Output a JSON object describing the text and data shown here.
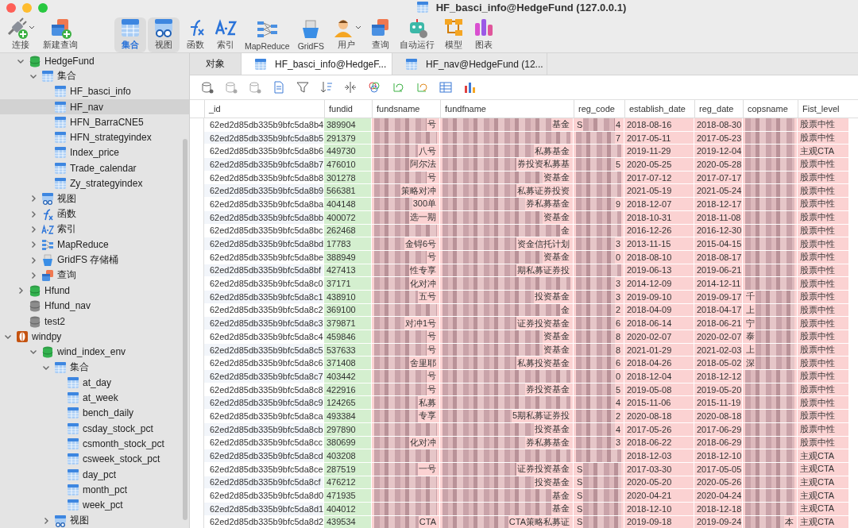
{
  "window": {
    "title": "HF_basci_info@HedgeFund (127.0.0.1)"
  },
  "toolbar": [
    {
      "kind": "connect",
      "label": "连接",
      "dropdown": true,
      "selected": false,
      "highlighted": false
    },
    {
      "kind": "new-query",
      "label": "新建查询",
      "dropdown": false,
      "selected": false,
      "highlighted": false
    },
    {
      "kind": "collection",
      "label": "集合",
      "dropdown": false,
      "selected": true,
      "highlighted": true
    },
    {
      "kind": "view",
      "label": "视图",
      "dropdown": false,
      "selected": false,
      "highlighted": true
    },
    {
      "kind": "function",
      "label": "函数",
      "dropdown": false,
      "selected": false,
      "highlighted": false
    },
    {
      "kind": "index",
      "label": "索引",
      "dropdown": false,
      "selected": false,
      "highlighted": false
    },
    {
      "kind": "mapreduce",
      "label": "MapReduce",
      "dropdown": false,
      "selected": false,
      "highlighted": false
    },
    {
      "kind": "gridfs",
      "label": "GridFS",
      "dropdown": false,
      "selected": false,
      "highlighted": false
    },
    {
      "kind": "user",
      "label": "用户",
      "dropdown": true,
      "selected": false,
      "highlighted": false
    },
    {
      "kind": "query",
      "label": "查询",
      "dropdown": false,
      "selected": false,
      "highlighted": false
    },
    {
      "kind": "robot",
      "label": "自动运行",
      "dropdown": false,
      "selected": false,
      "highlighted": false
    },
    {
      "kind": "model",
      "label": "模型",
      "dropdown": false,
      "selected": false,
      "highlighted": false
    },
    {
      "kind": "chart",
      "label": "图表",
      "dropdown": false,
      "selected": false,
      "highlighted": false
    }
  ],
  "sidebar": {
    "items": [
      {
        "kind": "database",
        "label": "HedgeFund",
        "expanded": true,
        "selected": false,
        "children": [
          {
            "kind": "collection",
            "label": "集合",
            "expanded": true,
            "selected": false,
            "children": [
              {
                "kind": "table",
                "label": "HF_basci_info",
                "selected": false
              },
              {
                "kind": "table",
                "label": "HF_nav",
                "selected": true
              },
              {
                "kind": "table",
                "label": "HFN_BarraCNE5",
                "selected": false
              },
              {
                "kind": "table",
                "label": "HFN_strategyindex",
                "selected": false
              },
              {
                "kind": "table",
                "label": "Index_price",
                "selected": false
              },
              {
                "kind": "table",
                "label": "Trade_calendar",
                "selected": false
              },
              {
                "kind": "table",
                "label": "Zy_strategyindex",
                "selected": false
              }
            ]
          },
          {
            "kind": "view",
            "label": "视图",
            "expanded": false,
            "selected": false
          },
          {
            "kind": "function",
            "label": "函数",
            "expanded": false,
            "selected": false
          },
          {
            "kind": "index",
            "label": "索引",
            "expanded": false,
            "selected": false
          },
          {
            "kind": "mapreduce",
            "label": "MapReduce",
            "expanded": false,
            "selected": false
          },
          {
            "kind": "gridfs",
            "label": "GridFS 存储桶",
            "expanded": false,
            "selected": false
          },
          {
            "kind": "query",
            "label": "查询",
            "expanded": false,
            "selected": false
          }
        ]
      },
      {
        "kind": "database",
        "label": "Hfund",
        "expanded": false,
        "selected": false
      },
      {
        "kind": "database-closed",
        "label": "Hfund_nav",
        "selected": false
      },
      {
        "kind": "database-closed",
        "label": "test2",
        "selected": false
      },
      {
        "kind": "connection",
        "label": "windpy",
        "expanded": true,
        "selected": false,
        "children": [
          {
            "kind": "database",
            "label": "wind_index_env",
            "expanded": true,
            "selected": false,
            "children": [
              {
                "kind": "collection",
                "label": "集合",
                "expanded": true,
                "selected": false,
                "children": [
                  {
                    "kind": "table",
                    "label": "at_day",
                    "selected": false
                  },
                  {
                    "kind": "table",
                    "label": "at_week",
                    "selected": false
                  },
                  {
                    "kind": "table",
                    "label": "bench_daily",
                    "selected": false
                  },
                  {
                    "kind": "table",
                    "label": "csday_stock_pct",
                    "selected": false
                  },
                  {
                    "kind": "table",
                    "label": "csmonth_stock_pct",
                    "selected": false
                  },
                  {
                    "kind": "table",
                    "label": "csweek_stock_pct",
                    "selected": false
                  },
                  {
                    "kind": "table",
                    "label": "day_pct",
                    "selected": false
                  },
                  {
                    "kind": "table",
                    "label": "month_pct",
                    "selected": false
                  },
                  {
                    "kind": "table",
                    "label": "week_pct",
                    "selected": false
                  }
                ]
              },
              {
                "kind": "view",
                "label": "视图",
                "expanded": false,
                "selected": false
              }
            ]
          }
        ]
      }
    ]
  },
  "tabs": [
    {
      "label": "对象",
      "selected": false,
      "icon": false
    },
    {
      "label": "HF_basci_info@HedgeF...",
      "selected": true,
      "icon": true
    },
    {
      "label": "HF_nav@HedgeFund (12...",
      "selected": false,
      "icon": true
    }
  ],
  "table": {
    "columns": [
      "_id",
      "fundid",
      "fundsname",
      "fundfname",
      "reg_code",
      "establish_date",
      "reg_date",
      "copsname",
      "Fist_level"
    ],
    "rows": [
      {
        "id": "62ed2d85db335b9bfc5da8b4",
        "fundid": "389904",
        "fundsname": "号",
        "fundfname": "基金",
        "reg_head": "S",
        "reg_tail": "4",
        "establish_date": "2018-08-16",
        "reg_date": "2018-08-30",
        "cops_head": "",
        "cops_tail": "",
        "level": "股票中性"
      },
      {
        "id": "62ed2d85db335b9bfc5da8b5",
        "fundid": "291379",
        "fundsname": "",
        "fundfname": "",
        "reg_head": "",
        "reg_tail": "7",
        "establish_date": "2017-05-11",
        "reg_date": "2017-05-23",
        "cops_head": "",
        "cops_tail": "",
        "level": "股票中性"
      },
      {
        "id": "62ed2d85db335b9bfc5da8b6",
        "fundid": "449730",
        "fundsname": "八号",
        "fundfname": "私募基金",
        "reg_head": "",
        "reg_tail": "",
        "establish_date": "2019-11-29",
        "reg_date": "2019-12-04",
        "cops_head": "",
        "cops_tail": "",
        "level": "主观CTA"
      },
      {
        "id": "62ed2d85db335b9bfc5da8b7",
        "fundid": "476010",
        "fundsname": "阿尔法",
        "fundfname": "券投资私募基",
        "reg_head": "",
        "reg_tail": "5",
        "establish_date": "2020-05-25",
        "reg_date": "2020-05-28",
        "cops_head": "",
        "cops_tail": "",
        "level": "股票中性"
      },
      {
        "id": "62ed2d85db335b9bfc5da8b8",
        "fundid": "301278",
        "fundsname": "号",
        "fundfname": "资基金",
        "reg_head": "",
        "reg_tail": "",
        "establish_date": "2017-07-12",
        "reg_date": "2017-07-17",
        "cops_head": "",
        "cops_tail": "",
        "level": "股票中性"
      },
      {
        "id": "62ed2d85db335b9bfc5da8b9",
        "fundid": "566381",
        "fundsname": "策略对冲",
        "fundfname": "私募证券投资",
        "reg_head": "",
        "reg_tail": "",
        "establish_date": "2021-05-19",
        "reg_date": "2021-05-24",
        "cops_head": "",
        "cops_tail": "",
        "level": "股票中性"
      },
      {
        "id": "62ed2d85db335b9bfc5da8ba",
        "fundid": "404148",
        "fundsname": "300单",
        "fundfname": "券私募基金",
        "reg_head": "",
        "reg_tail": "9",
        "establish_date": "2018-12-07",
        "reg_date": "2018-12-17",
        "cops_head": "",
        "cops_tail": "",
        "level": "股票中性"
      },
      {
        "id": "62ed2d85db335b9bfc5da8bb",
        "fundid": "400072",
        "fundsname": "选一期",
        "fundfname": "资基金",
        "reg_head": "",
        "reg_tail": "",
        "establish_date": "2018-10-31",
        "reg_date": "2018-11-08",
        "cops_head": "",
        "cops_tail": "",
        "level": "股票中性"
      },
      {
        "id": "62ed2d85db335b9bfc5da8bc",
        "fundid": "262468",
        "fundsname": "",
        "fundfname": "金",
        "reg_head": "",
        "reg_tail": "",
        "establish_date": "2016-12-26",
        "reg_date": "2016-12-30",
        "cops_head": "",
        "cops_tail": "",
        "level": "股票中性"
      },
      {
        "id": "62ed2d85db335b9bfc5da8bd",
        "fundid": "17783",
        "fundsname": "金锝6号",
        "fundfname": "资金信托计划",
        "reg_head": "",
        "reg_tail": "3",
        "establish_date": "2013-11-15",
        "reg_date": "2015-04-15",
        "cops_head": "",
        "cops_tail": "",
        "level": "股票中性"
      },
      {
        "id": "62ed2d85db335b9bfc5da8be",
        "fundid": "388949",
        "fundsname": "号",
        "fundfname": "资基金",
        "reg_head": "",
        "reg_tail": "0",
        "establish_date": "2018-08-10",
        "reg_date": "2018-08-17",
        "cops_head": "",
        "cops_tail": "",
        "level": "股票中性"
      },
      {
        "id": "62ed2d85db335b9bfc5da8bf",
        "fundid": "427413",
        "fundsname": "性专享",
        "fundfname": "期私募证券投",
        "reg_head": "",
        "reg_tail": "",
        "establish_date": "2019-06-13",
        "reg_date": "2019-06-21",
        "cops_head": "",
        "cops_tail": "",
        "level": "股票中性"
      },
      {
        "id": "62ed2d85db335b9bfc5da8c0",
        "fundid": "37171",
        "fundsname": "化对冲",
        "fundfname": "",
        "reg_head": "",
        "reg_tail": "3",
        "establish_date": "2014-12-09",
        "reg_date": "2014-12-11",
        "cops_head": "",
        "cops_tail": "",
        "level": "股票中性"
      },
      {
        "id": "62ed2d85db335b9bfc5da8c1",
        "fundid": "438910",
        "fundsname": "五号",
        "fundfname": "投资基金",
        "reg_head": "",
        "reg_tail": "3",
        "establish_date": "2019-09-10",
        "reg_date": "2019-09-17",
        "cops_head": "千",
        "cops_tail": "",
        "level": "股票中性"
      },
      {
        "id": "62ed2d85db335b9bfc5da8c2",
        "fundid": "369100",
        "fundsname": "",
        "fundfname": "金",
        "reg_head": "",
        "reg_tail": "2",
        "establish_date": "2018-04-09",
        "reg_date": "2018-04-17",
        "cops_head": "上",
        "cops_tail": "",
        "level": "股票中性"
      },
      {
        "id": "62ed2d85db335b9bfc5da8c3",
        "fundid": "379871",
        "fundsname": "对冲1号",
        "fundfname": "证券投资基金",
        "reg_head": "",
        "reg_tail": "6",
        "establish_date": "2018-06-14",
        "reg_date": "2018-06-21",
        "cops_head": "宁",
        "cops_tail": "",
        "level": "股票中性"
      },
      {
        "id": "62ed2d85db335b9bfc5da8c4",
        "fundid": "459846",
        "fundsname": "号",
        "fundfname": "资基金",
        "reg_head": "",
        "reg_tail": "8",
        "establish_date": "2020-02-07",
        "reg_date": "2020-02-07",
        "cops_head": "泰",
        "cops_tail": "",
        "level": "股票中性"
      },
      {
        "id": "62ed2d85db335b9bfc5da8c5",
        "fundid": "537633",
        "fundsname": "号",
        "fundfname": "资基金",
        "reg_head": "",
        "reg_tail": "8",
        "establish_date": "2021-01-29",
        "reg_date": "2021-02-03",
        "cops_head": "上",
        "cops_tail": "",
        "level": "股票中性"
      },
      {
        "id": "62ed2d85db335b9bfc5da8c6",
        "fundid": "371408",
        "fundsname": "舍里耶",
        "fundfname": "私募投资基金",
        "reg_head": "",
        "reg_tail": "6",
        "establish_date": "2018-04-26",
        "reg_date": "2018-05-02",
        "cops_head": "深",
        "cops_tail": "",
        "level": "股票中性"
      },
      {
        "id": "62ed2d85db335b9bfc5da8c7",
        "fundid": "403442",
        "fundsname": "号",
        "fundfname": "",
        "reg_head": "",
        "reg_tail": "0",
        "establish_date": "2018-12-04",
        "reg_date": "2018-12-12",
        "cops_head": "",
        "cops_tail": "",
        "level": "股票中性"
      },
      {
        "id": "62ed2d85db335b9bfc5da8c8",
        "fundid": "422916",
        "fundsname": "号",
        "fundfname": "券投资基金",
        "reg_head": "",
        "reg_tail": "5",
        "establish_date": "2019-05-08",
        "reg_date": "2019-05-20",
        "cops_head": "",
        "cops_tail": "",
        "level": "股票中性"
      },
      {
        "id": "62ed2d85db335b9bfc5da8c9",
        "fundid": "124265",
        "fundsname": "私募",
        "fundfname": "",
        "reg_head": "",
        "reg_tail": "4",
        "establish_date": "2015-11-06",
        "reg_date": "2015-11-19",
        "cops_head": "",
        "cops_tail": "",
        "level": "股票中性"
      },
      {
        "id": "62ed2d85db335b9bfc5da8ca",
        "fundid": "493384",
        "fundsname": "专享",
        "fundfname": "5期私募证券投",
        "reg_head": "",
        "reg_tail": "2",
        "establish_date": "2020-08-18",
        "reg_date": "2020-08-18",
        "cops_head": "",
        "cops_tail": "",
        "level": "股票中性"
      },
      {
        "id": "62ed2d85db335b9bfc5da8cb",
        "fundid": "297890",
        "fundsname": "",
        "fundfname": "投资基金",
        "reg_head": "",
        "reg_tail": "4",
        "establish_date": "2017-05-26",
        "reg_date": "2017-06-29",
        "cops_head": "",
        "cops_tail": "",
        "level": "股票中性"
      },
      {
        "id": "62ed2d85db335b9bfc5da8cc",
        "fundid": "380699",
        "fundsname": "化对冲",
        "fundfname": "券私募基金",
        "reg_head": "",
        "reg_tail": "3",
        "establish_date": "2018-06-22",
        "reg_date": "2018-06-29",
        "cops_head": "",
        "cops_tail": "",
        "level": "股票中性"
      },
      {
        "id": "62ed2d85db335b9bfc5da8cd",
        "fundid": "403208",
        "fundsname": "",
        "fundfname": "",
        "reg_head": "",
        "reg_tail": "",
        "establish_date": "2018-12-03",
        "reg_date": "2018-12-10",
        "cops_head": "",
        "cops_tail": "",
        "level": "主观CTA"
      },
      {
        "id": "62ed2d85db335b9bfc5da8ce",
        "fundid": "287519",
        "fundsname": "一号",
        "fundfname": "证券投资基金",
        "reg_head": "S",
        "reg_tail": "",
        "establish_date": "2017-03-30",
        "reg_date": "2017-05-05",
        "cops_head": "",
        "cops_tail": "",
        "level": "主观CTA"
      },
      {
        "id": "62ed2d85db335b9bfc5da8cf",
        "fundid": "476212",
        "fundsname": "",
        "fundfname": "投资基金",
        "reg_head": "S",
        "reg_tail": "",
        "establish_date": "2020-05-20",
        "reg_date": "2020-05-26",
        "cops_head": "",
        "cops_tail": "",
        "level": "主观CTA"
      },
      {
        "id": "62ed2d85db335b9bfc5da8d0",
        "fundid": "471935",
        "fundsname": "",
        "fundfname": "基金",
        "reg_head": "S",
        "reg_tail": "",
        "establish_date": "2020-04-21",
        "reg_date": "2020-04-24",
        "cops_head": "",
        "cops_tail": "",
        "level": "主观CTA"
      },
      {
        "id": "62ed2d85db335b9bfc5da8d1",
        "fundid": "404012",
        "fundsname": "",
        "fundfname": "基金",
        "reg_head": "S",
        "reg_tail": "",
        "establish_date": "2018-12-10",
        "reg_date": "2018-12-18",
        "cops_head": "",
        "cops_tail": "",
        "level": "主观CTA"
      },
      {
        "id": "62ed2d85db335b9bfc5da8d2",
        "fundid": "439534",
        "fundsname": "CTA",
        "fundfname": "CTA策略私募证",
        "reg_head": "S",
        "reg_tail": "",
        "establish_date": "2019-09-18",
        "reg_date": "2019-09-24",
        "cops_head": "",
        "cops_tail": "本",
        "level": "主观CTA"
      }
    ]
  }
}
